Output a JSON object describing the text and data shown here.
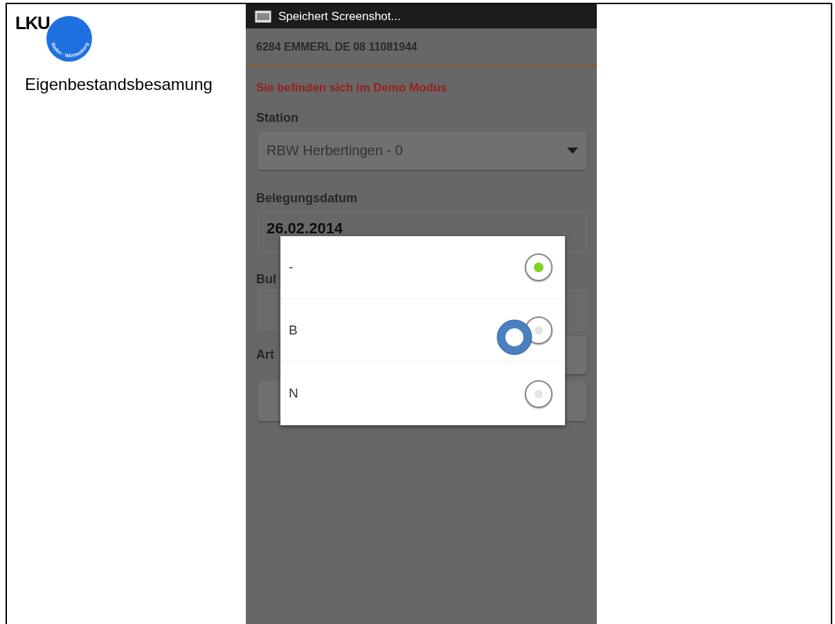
{
  "slide": {
    "logo": {
      "letters": "LKU",
      "arc_text": "Baden · Württemberg"
    },
    "title": "Eigenbestandsbesamung"
  },
  "phone": {
    "status_bar": {
      "notification": "Speichert Screenshot..."
    },
    "header": "6284 EMMERL DE 08 11081944",
    "demo_notice": "Sie befinden sich im Demo Modus",
    "station": {
      "label": "Station",
      "value": "RBW Herbertingen - 0"
    },
    "date": {
      "label": "Belegungsdatum",
      "value": "26.02.2014"
    },
    "bull_label": "Bul",
    "art_label": "Art",
    "dialog": {
      "options": [
        {
          "label": "-",
          "selected": true
        },
        {
          "label": "B",
          "selected": false
        },
        {
          "label": "N",
          "selected": false
        }
      ]
    }
  }
}
